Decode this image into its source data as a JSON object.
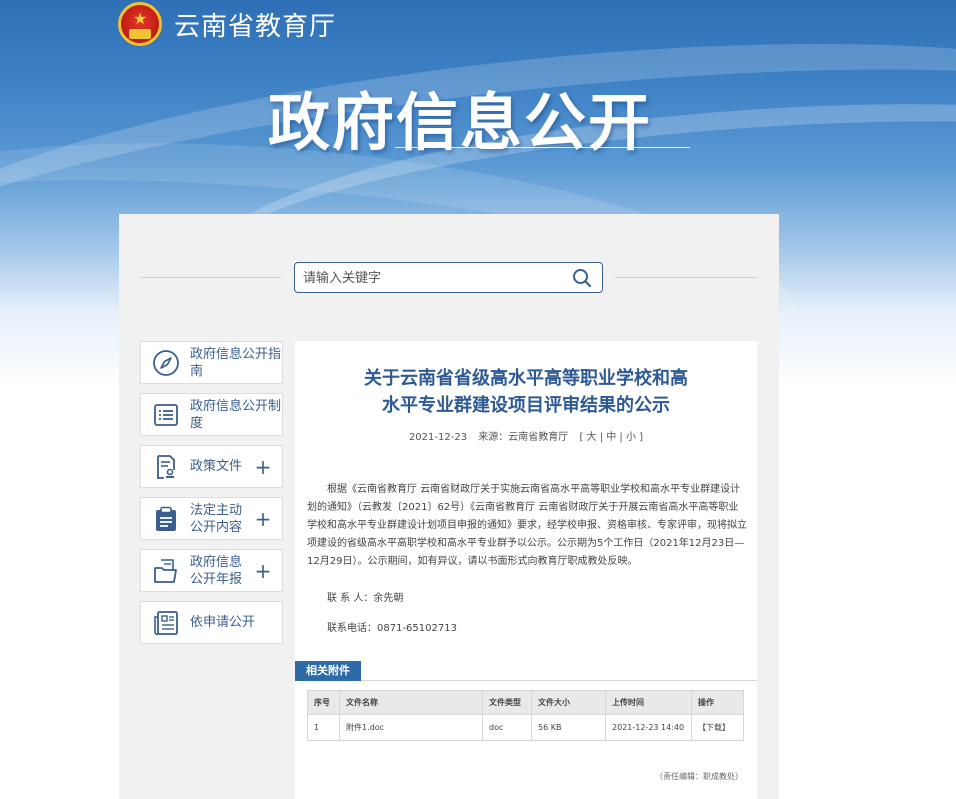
{
  "header": {
    "site_name": "云南省教育厅",
    "hero_title": "政府信息公开"
  },
  "search": {
    "placeholder": "请输入关键字"
  },
  "sidebar": {
    "items": [
      {
        "label": "政府信息公开指南",
        "icon": "compass-icon",
        "expandable": false
      },
      {
        "label": "政府信息公开制度",
        "icon": "list-icon",
        "expandable": false
      },
      {
        "label": "政策文件",
        "icon": "document-stamp-icon",
        "expandable": true
      },
      {
        "label": "法定主动公开内容",
        "icon": "clipboard-icon",
        "expandable": true
      },
      {
        "label": "政府信息公开年报",
        "icon": "folder-icon",
        "expandable": true
      },
      {
        "label": "依申请公开",
        "icon": "newspaper-icon",
        "expandable": false
      }
    ],
    "plus_symbol": "+"
  },
  "article": {
    "title_line1": "关于云南省省级高水平高等职业学校和高",
    "title_line2": "水平专业群建设项目评审结果的公示",
    "date": "2021-12-23",
    "source": "来源：云南省教育厅",
    "font_size_switch": "[ 大 | 中 | 小 ]",
    "body": "根据《云南省教育厅 云南省财政厅关于实施云南省高水平高等职业学校和高水平专业群建设计划的通知》（云教发〔2021〕62号）《云南省教育厅 云南省财政厅关于开展云南省高水平高等职业学校和高水平专业群建设计划项目申报的通知》要求，经学校申报、资格审核、专家评审，现将拟立项建设的省级高水平高职学校和高水平专业群予以公示。公示期为5个工作日（2021年12月23日—12月29日）。公示期间，如有异议，请以书面形式向教育厅职成教处反映。",
    "contact_person": "联 系 人：余先朝",
    "contact_phone": "联系电话：0871-65102713",
    "editor": "（责任编辑：职成教处）"
  },
  "attachments": {
    "tab_label": "相关附件",
    "columns": [
      "序号",
      "文件名称",
      "文件类型",
      "文件大小",
      "上传时间",
      "操作"
    ],
    "rows": [
      [
        "1",
        "附件1.doc",
        "doc",
        "56 KB",
        "2021-12-23 14:40",
        "【下载】"
      ]
    ]
  },
  "colors": {
    "accent": "#2e5a94",
    "tab": "#2d6aa8"
  }
}
